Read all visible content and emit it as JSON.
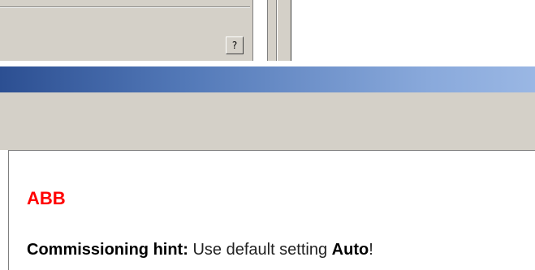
{
  "top": {
    "help_button_label": "?"
  },
  "content": {
    "brand": "ABB",
    "hint_label": "Commissioning hint:",
    "hint_text_before": " Use default setting ",
    "hint_value": "Auto",
    "hint_text_after": "!"
  },
  "colors": {
    "brand": "#ff0000",
    "title_bar_start": "#2c4f92",
    "title_bar_end": "#9ab7e4",
    "panel_bg": "#d4d0c8"
  }
}
